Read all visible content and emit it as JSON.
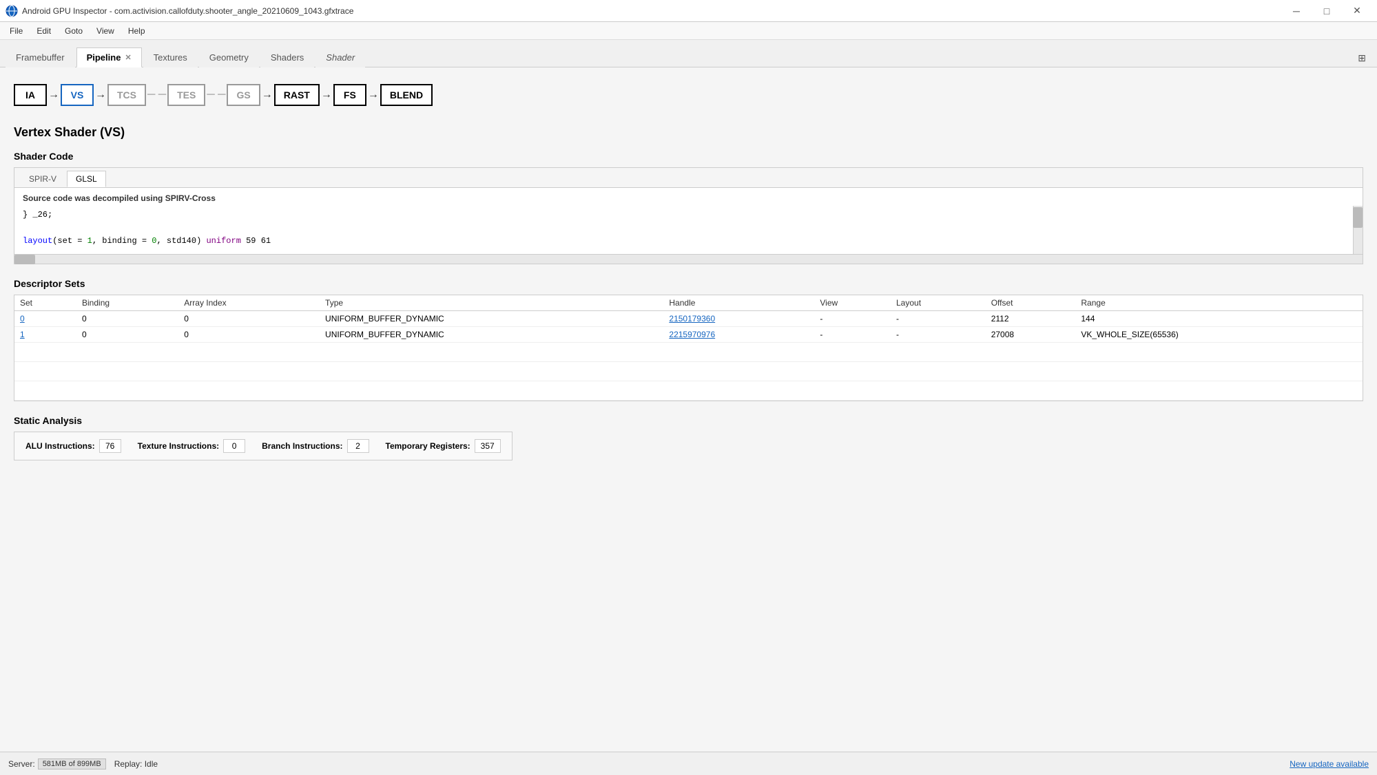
{
  "titleBar": {
    "title": "Android GPU Inspector - com.activision.callofduty.shooter_angle_20210609_1043.gfxtrace",
    "minBtn": "─",
    "maxBtn": "□",
    "closeBtn": "✕"
  },
  "menuBar": {
    "items": [
      "File",
      "Edit",
      "Goto",
      "View",
      "Help"
    ]
  },
  "tabs": [
    {
      "label": "Framebuffer",
      "active": false,
      "closable": false
    },
    {
      "label": "Pipeline",
      "active": true,
      "closable": true
    },
    {
      "label": "Textures",
      "active": false,
      "closable": false
    },
    {
      "label": "Geometry",
      "active": false,
      "closable": false
    },
    {
      "label": "Shaders",
      "active": false,
      "closable": false
    },
    {
      "label": "Shader",
      "active": false,
      "closable": false,
      "italic": true
    }
  ],
  "pipeline": {
    "nodes": [
      {
        "label": "IA",
        "state": "normal"
      },
      {
        "label": "VS",
        "state": "active"
      },
      {
        "label": "TCS",
        "state": "dim"
      },
      {
        "label": "TES",
        "state": "dim"
      },
      {
        "label": "GS",
        "state": "dim"
      },
      {
        "label": "RAST",
        "state": "normal"
      },
      {
        "label": "FS",
        "state": "normal"
      },
      {
        "label": "BLEND",
        "state": "normal"
      }
    ]
  },
  "vertexShader": {
    "title": "Vertex Shader (VS)",
    "shaderCode": {
      "title": "Shader Code",
      "tabs": [
        "SPIR-V",
        "GLSL"
      ],
      "activeTab": "GLSL",
      "notice": "Source code was decompiled using SPIRV-Cross",
      "lines": [
        {
          "text": "} _26;",
          "type": "normal"
        },
        {
          "text": "",
          "type": "normal"
        },
        {
          "text": "layout(set = 1, binding = 0, std140) uniform 59 61",
          "type": "code"
        }
      ]
    },
    "descriptorSets": {
      "title": "Descriptor Sets",
      "columns": [
        "Set",
        "Binding",
        "Array Index",
        "Type",
        "Handle",
        "View",
        "Layout",
        "Offset",
        "Range"
      ],
      "rows": [
        {
          "set": "0",
          "binding": "0",
          "arrayIndex": "0",
          "type": "UNIFORM_BUFFER_DYNAMIC",
          "handle": "2150179360",
          "view": "-",
          "layout": "-",
          "offset": "2112",
          "range": "144"
        },
        {
          "set": "1",
          "binding": "0",
          "arrayIndex": "0",
          "type": "UNIFORM_BUFFER_DYNAMIC",
          "handle": "2215970976",
          "view": "-",
          "layout": "-",
          "offset": "27008",
          "range": "VK_WHOLE_SIZE(65536)"
        }
      ]
    },
    "staticAnalysis": {
      "title": "Static Analysis",
      "items": [
        {
          "label": "ALU Instructions:",
          "value": "76"
        },
        {
          "label": "Texture Instructions:",
          "value": "0"
        },
        {
          "label": "Branch Instructions:",
          "value": "2"
        },
        {
          "label": "Temporary Registers:",
          "value": "357"
        }
      ]
    }
  },
  "statusBar": {
    "serverLabel": "Server:",
    "memUsage": "581MB of 899MB",
    "replayLabel": "Replay: Idle",
    "updateLink": "New update available"
  }
}
